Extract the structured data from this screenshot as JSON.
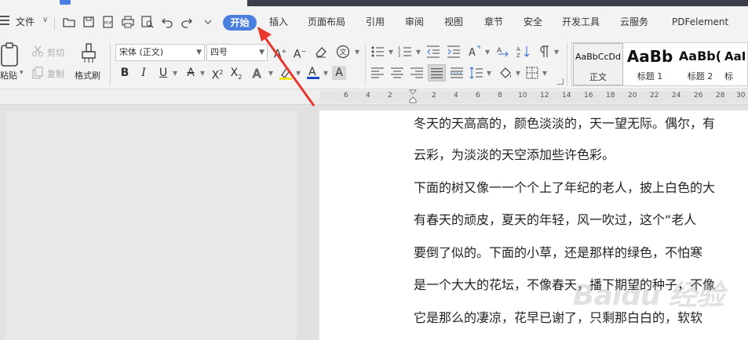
{
  "menu": {
    "file": "文件",
    "tabs": [
      "开始",
      "插入",
      "页面布局",
      "引用",
      "审阅",
      "视图",
      "章节",
      "安全",
      "开发工具",
      "云服务",
      "PDFelement"
    ]
  },
  "ribbon": {
    "paste": "粘贴",
    "cut": "剪切",
    "copy": "复制",
    "format_painter": "格式刷",
    "font_name": "宋体 (正文)",
    "font_size": "四号"
  },
  "styles": [
    {
      "preview": "AaBbCcDd",
      "name": "正文"
    },
    {
      "preview": "AaBb",
      "name": "标题 1"
    },
    {
      "preview": "AaBb(",
      "name": "标题 2"
    },
    {
      "preview": "AaI",
      "name": "标"
    }
  ],
  "ruler": [
    "6",
    "4",
    "2",
    "2",
    "4",
    "6",
    "8",
    "10",
    "12",
    "14",
    "16",
    "18",
    "20",
    "22",
    "24",
    "26",
    "28",
    "30"
  ],
  "document": {
    "lines": [
      "冬天的天高高的，颜色淡淡的，天一望无际。偶尔，有",
      "云彩，为淡淡的天空添加些许色彩。",
      "下面的树又像一一个个上了年纪的老人，披上白色的大",
      "有春天的顽皮，夏天的年轻，风一吹过，这个“老人",
      "要倒了似的。下面的小草，还是那样的绿色，不怕寒",
      "是一个大大的花坛，不像春天，播下期望的种子，不像",
      "它是那么的凄凉，花早已谢了，只剩那白白的，软软"
    ]
  },
  "watermark": "Baidu 经验",
  "colors": {
    "accent": "#4a7fe0",
    "arrow": "#e8372c"
  }
}
